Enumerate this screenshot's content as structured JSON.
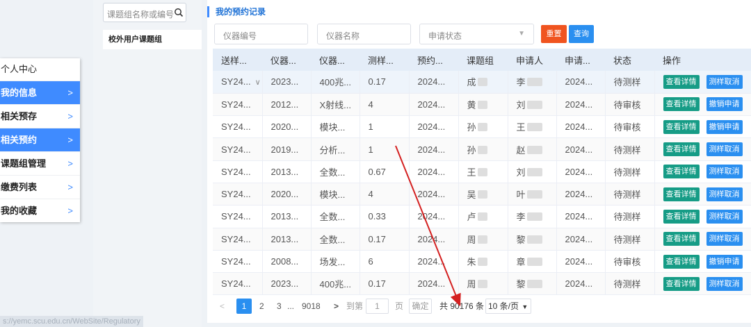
{
  "sidebar": {
    "title": "个人中心",
    "items": [
      {
        "label": "我的信息",
        "active": true
      },
      {
        "label": "相关预存",
        "active": false
      },
      {
        "label": "相关预约",
        "active": true
      },
      {
        "label": "课题组管理",
        "active": false
      },
      {
        "label": "缴费列表",
        "active": false
      },
      {
        "label": "我的收藏",
        "active": false
      }
    ],
    "chevron": ">"
  },
  "group_panel": {
    "search_placeholder": "课题组名称或编号",
    "search_icon": "search-icon",
    "item": "校外用户课题组"
  },
  "main": {
    "title": "我的预约记录",
    "filters": {
      "instrument_no_placeholder": "仪器编号",
      "instrument_name_placeholder": "仪器名称",
      "status_placeholder": "申请状态"
    },
    "reset_label": "重置",
    "query_label": "查询",
    "table": {
      "columns": [
        "送样...",
        "仪器...",
        "仪器...",
        "测样...",
        "预约...",
        "课题组",
        "申请人",
        "申请...",
        "状态",
        "操作"
      ],
      "rows": [
        {
          "c0": "SY24...",
          "c1": "2023...",
          "c2": "400兆...",
          "c3": "0.17",
          "c4": "2024...",
          "c5": "成",
          "c6": "李",
          "c7": "2024...",
          "c8": "待测样",
          "detail": "查看详情",
          "action": "测样取消"
        },
        {
          "c0": "SY24...",
          "c1": "2012...",
          "c2": "X射线...",
          "c3": "4",
          "c4": "2024...",
          "c5": "黄",
          "c6": "刘",
          "c7": "2024...",
          "c8": "待审核",
          "detail": "查看详情",
          "action": "撤销申请"
        },
        {
          "c0": "SY24...",
          "c1": "2020...",
          "c2": "模块...",
          "c3": "1",
          "c4": "2024...",
          "c5": "孙",
          "c6": "王",
          "c7": "2024...",
          "c8": "待审核",
          "detail": "查看详情",
          "action": "撤销申请"
        },
        {
          "c0": "SY24...",
          "c1": "2019...",
          "c2": "分析...",
          "c3": "1",
          "c4": "2024...",
          "c5": "孙",
          "c6": "赵",
          "c7": "2024...",
          "c8": "待测样",
          "detail": "查看详情",
          "action": "测样取消"
        },
        {
          "c0": "SY24...",
          "c1": "2013...",
          "c2": "全数...",
          "c3": "0.67",
          "c4": "2024...",
          "c5": "王",
          "c6": "刘",
          "c7": "2024...",
          "c8": "待测样",
          "detail": "查看详情",
          "action": "测样取消"
        },
        {
          "c0": "SY24...",
          "c1": "2020...",
          "c2": "模块...",
          "c3": "4",
          "c4": "2024...",
          "c5": "吴",
          "c6": "叶",
          "c7": "2024...",
          "c8": "待测样",
          "detail": "查看详情",
          "action": "测样取消"
        },
        {
          "c0": "SY24...",
          "c1": "2013...",
          "c2": "全数...",
          "c3": "0.33",
          "c4": "2024...",
          "c5": "卢",
          "c6": "李",
          "c7": "2024...",
          "c8": "待测样",
          "detail": "查看详情",
          "action": "测样取消"
        },
        {
          "c0": "SY24...",
          "c1": "2013...",
          "c2": "全数...",
          "c3": "0.17",
          "c4": "2024...",
          "c5": "周",
          "c6": "黎",
          "c7": "2024...",
          "c8": "待测样",
          "detail": "查看详情",
          "action": "测样取消"
        },
        {
          "c0": "SY24...",
          "c1": "2008...",
          "c2": "场发...",
          "c3": "6",
          "c4": "2024...",
          "c5": "朱",
          "c6": "章",
          "c7": "2024...",
          "c8": "待审核",
          "detail": "查看详情",
          "action": "撤销申请"
        },
        {
          "c0": "SY24...",
          "c1": "2023...",
          "c2": "400兆...",
          "c3": "0.17",
          "c4": "2024...",
          "c5": "周",
          "c6": "黎",
          "c7": "2024...",
          "c8": "待测样",
          "detail": "查看详情",
          "action": "测样取消"
        }
      ]
    },
    "pagination": {
      "prev": "<",
      "pages": [
        "1",
        "2",
        "3"
      ],
      "ellipsis": "...",
      "last_page": "9018",
      "next": ">",
      "goto_prefix": "到第",
      "goto_value": "1",
      "goto_suffix": "页",
      "confirm": "确定",
      "total": "共 90176 条",
      "page_size": "10 条/页"
    }
  },
  "status_url": "s://yemc.scu.edu.cn/WebSite/Regulatory",
  "colors": {
    "accent": "#3f8bff",
    "reset": "#f0541f",
    "query": "#2a8ff0",
    "detail": "#169c86",
    "arrow": "#d42020"
  }
}
